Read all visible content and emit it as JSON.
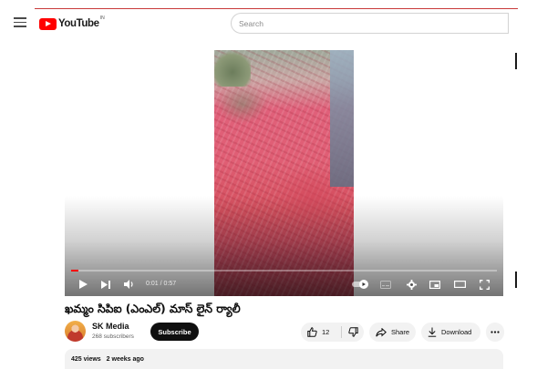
{
  "masthead": {
    "logo_text": "YouTube",
    "country_code": "IN",
    "search_placeholder": "Search"
  },
  "player": {
    "current_time": "0:01",
    "time_separator": "/",
    "duration": "0:57",
    "progress_fraction": 0.018,
    "accent_color": "#ff0000"
  },
  "video": {
    "title": "ఖమ్మం సిపిఐ (ఎంఎల్) మాస్ లైన్ ర్యాలీ"
  },
  "owner": {
    "channel_name": "SK Media",
    "subscriber_count": "268 subscribers",
    "subscribe_label": "Subscribe"
  },
  "actions": {
    "like_count": "12",
    "share_label": "Share",
    "download_label": "Download"
  },
  "description": {
    "views": "425 views",
    "uploaded": "2 weeks ago"
  },
  "icons": [
    "menu-icon",
    "youtube-logo-icon",
    "play-icon",
    "next-icon",
    "volume-icon",
    "autoplay-toggle-icon",
    "subtitles-icon",
    "settings-icon",
    "miniplayer-icon",
    "theater-icon",
    "fullscreen-icon",
    "like-icon",
    "dislike-icon",
    "share-icon",
    "download-icon",
    "more-icon"
  ]
}
